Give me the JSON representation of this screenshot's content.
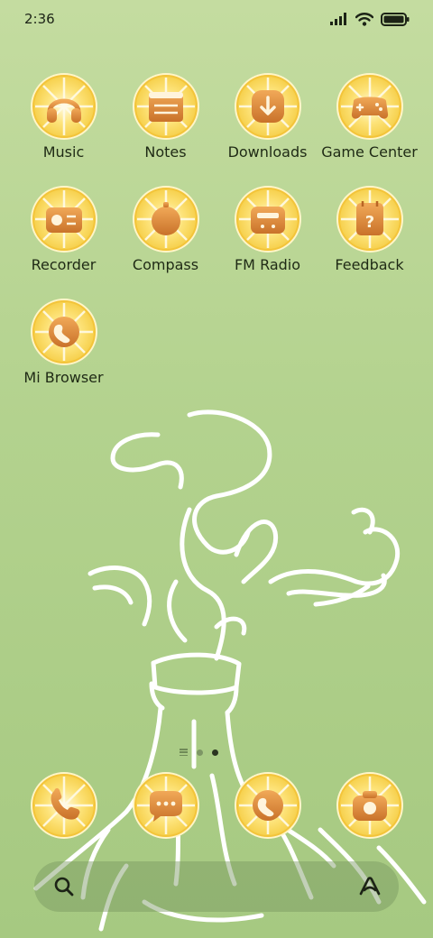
{
  "status_bar": {
    "time": "2:36",
    "signal_icon": "signal-icon",
    "wifi_icon": "wifi-icon",
    "battery_icon": "battery-icon"
  },
  "apps": [
    {
      "label": "Music",
      "icon": "headphones-icon"
    },
    {
      "label": "Notes",
      "icon": "notepad-icon"
    },
    {
      "label": "Downloads",
      "icon": "download-icon"
    },
    {
      "label": "Game Center",
      "icon": "gamepad-icon"
    },
    {
      "label": "Recorder",
      "icon": "recorder-icon"
    },
    {
      "label": "Compass",
      "icon": "compass-icon"
    },
    {
      "label": "FM Radio",
      "icon": "radio-icon"
    },
    {
      "label": "Feedback",
      "icon": "feedback-icon"
    },
    {
      "label": "Mi Browser",
      "icon": "globe-icon"
    }
  ],
  "page_indicator": {
    "pages": 2,
    "active_page": 2
  },
  "dock": [
    {
      "icon": "phone-icon"
    },
    {
      "icon": "messages-icon"
    },
    {
      "icon": "browser-icon"
    },
    {
      "icon": "camera-icon"
    }
  ],
  "search": {
    "left_icon": "search-icon",
    "right_icon": "assistant-icon"
  },
  "colors": {
    "background": "#b7d492",
    "icon_rim": "#fbe87a",
    "icon_glyph": "#d9873a",
    "wallpaper_line": "#ffffff"
  }
}
